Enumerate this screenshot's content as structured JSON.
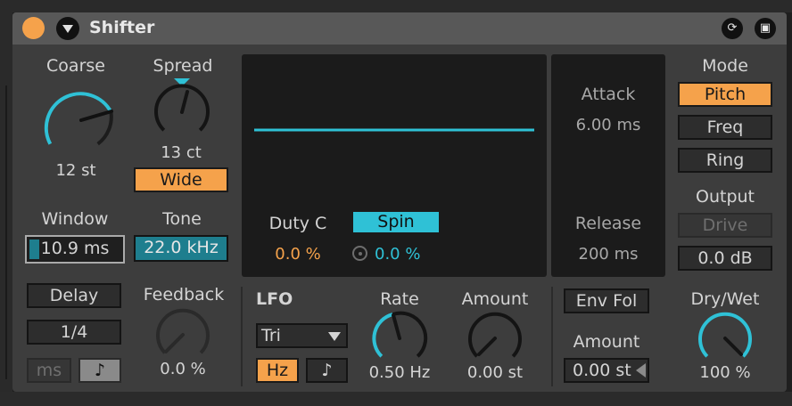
{
  "header": {
    "title": "Shifter"
  },
  "coarse": {
    "label": "Coarse",
    "value": "12 st"
  },
  "spread": {
    "label": "Spread",
    "value": "13 ct",
    "wide_label": "Wide"
  },
  "window": {
    "label": "Window",
    "value": "10.9 ms"
  },
  "tone": {
    "label": "Tone",
    "value": "22.0 kHz"
  },
  "display": {
    "duty_label": "Duty C",
    "duty_value": "0.0 %",
    "spin_label": "Spin",
    "spin_value": "0.0 %"
  },
  "envelope": {
    "attack_label": "Attack",
    "attack_value": "6.00 ms",
    "release_label": "Release",
    "release_value": "200 ms"
  },
  "mode": {
    "label": "Mode",
    "options": [
      "Pitch",
      "Freq",
      "Ring"
    ],
    "selected": "Pitch"
  },
  "output": {
    "label": "Output",
    "drive_label": "Drive",
    "gain_value": "0.0 dB"
  },
  "delay": {
    "button_label": "Delay",
    "time_value": "1/4",
    "ms_label": "ms",
    "note_symbol": "♪",
    "feedback_label": "Feedback",
    "feedback_value": "0.0 %"
  },
  "lfo": {
    "label": "LFO",
    "waveform": "Tri",
    "hz_label": "Hz",
    "note_symbol": "♪",
    "rate_label": "Rate",
    "rate_value": "0.50 Hz",
    "amount_label": "Amount",
    "amount_value": "0.00 st"
  },
  "env_fol": {
    "button_label": "Env Fol",
    "amount_label": "Amount",
    "amount_value": "0.00 st"
  },
  "drywet": {
    "label": "Dry/Wet",
    "value": "100 %"
  },
  "colors": {
    "accent_orange": "#f5a24b",
    "accent_cyan": "#2fc1d6",
    "panel_bg": "#3d3d3d",
    "display_bg": "#1b1b1b"
  }
}
